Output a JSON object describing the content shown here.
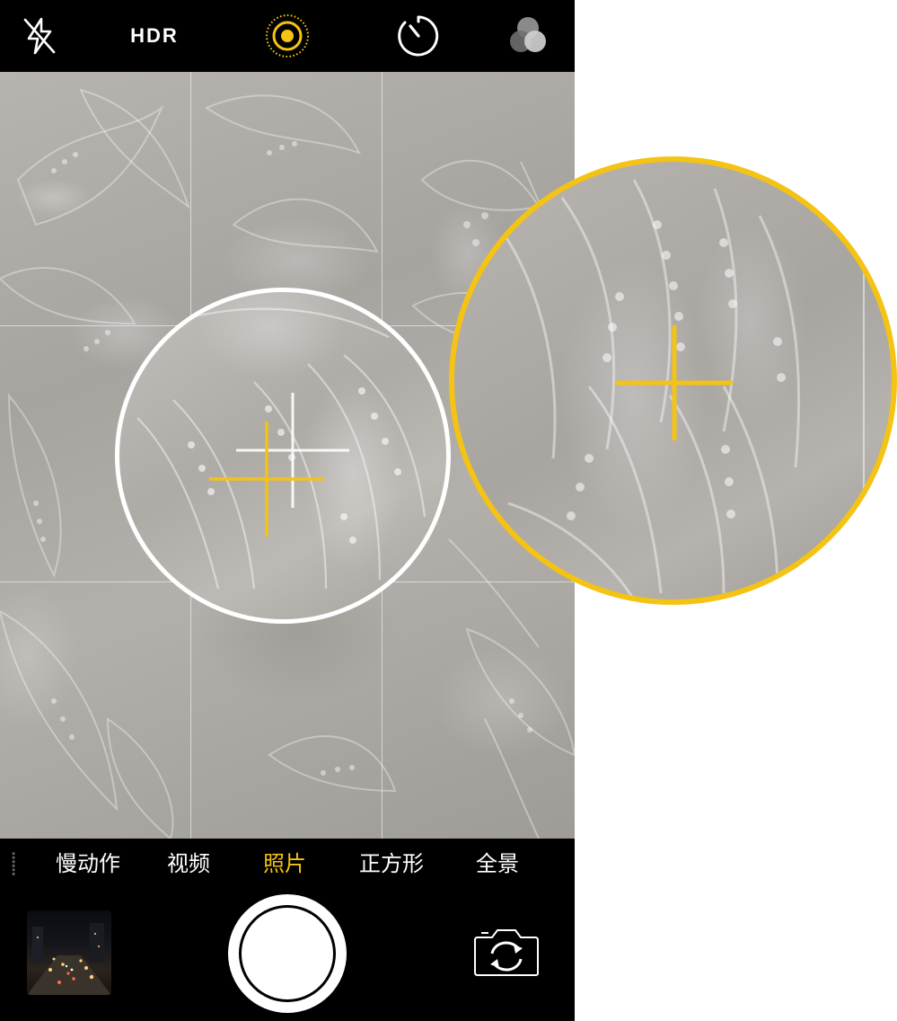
{
  "top_bar": {
    "flash_icon": "flash-off-icon",
    "hdr_label": "HDR",
    "live_photo_icon": "live-photo-icon",
    "timer_icon": "timer-icon",
    "filters_icon": "filters-icon"
  },
  "viewfinder": {
    "grid": "3x3",
    "focus_marker": "crosshair",
    "magnifier_small_border": "#ffffff",
    "magnifier_large_border": "#f4c314",
    "crosshair_color": "#f4c314"
  },
  "modes": {
    "items": [
      {
        "label": "慢动作",
        "active": false
      },
      {
        "label": "视频",
        "active": false
      },
      {
        "label": "照片",
        "active": true
      },
      {
        "label": "正方形",
        "active": false
      },
      {
        "label": "全景",
        "active": false
      }
    ],
    "active_color": "#f4c314"
  },
  "bottom_bar": {
    "thumbnail_icon": "last-photo-thumbnail",
    "shutter_icon": "shutter-button",
    "switch_camera_icon": "switch-camera-icon"
  }
}
